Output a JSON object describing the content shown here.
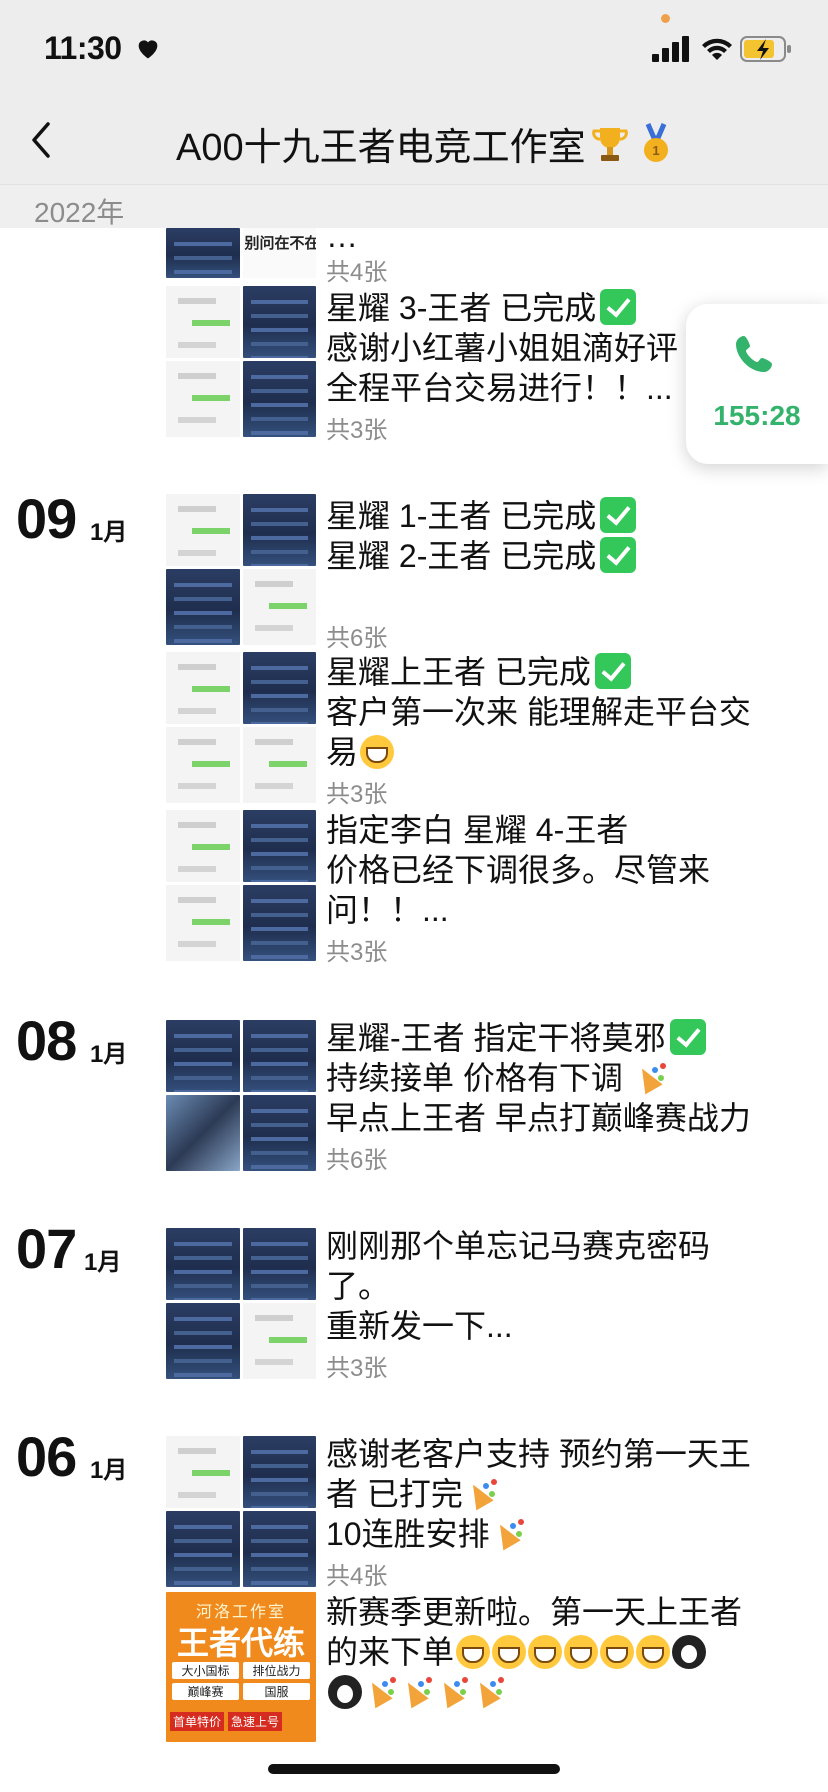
{
  "status": {
    "time": "11:30"
  },
  "nav": {
    "title": "A00十九王者电竞工作室"
  },
  "year": "2022年",
  "call": {
    "duration": "155:28"
  },
  "days": [
    {
      "day": "09",
      "month": "1月"
    },
    {
      "day": "08",
      "month": "1月"
    },
    {
      "day": "07",
      "month": "1月"
    },
    {
      "day": "06",
      "month": "1月"
    }
  ],
  "posts": [
    {
      "lines": [
        "…"
      ],
      "count": "共4张"
    },
    {
      "lines": [
        "星耀 3-王者  已完成",
        "感谢小红薯小姐姐滴好评",
        "全程平台交易进行！！..."
      ],
      "count": "共3张"
    },
    {
      "lines": [
        "星耀 1-王者  已完成",
        "星耀 2-王者  已完成"
      ],
      "count": "共6张"
    },
    {
      "lines": [
        "星耀上王者  已完成",
        "客户第一次来 能理解走平台交",
        "易"
      ],
      "count": "共3张"
    },
    {
      "lines": [
        "指定李白 星耀 4-王者",
        "价格已经下调很多。尽管来",
        "问！！..."
      ],
      "count": "共3张"
    },
    {
      "lines": [
        "星耀-王者 指定干将莫邪",
        "持续接单 价格有下调",
        "早点上王者 早点打巅峰赛战力"
      ],
      "count": "共6张"
    },
    {
      "lines": [
        "刚刚那个单忘记马赛克密码",
        "了。",
        "重新发一下..."
      ],
      "count": "共3张"
    },
    {
      "lines": [
        "感谢老客户支持 预约第一天王",
        "者 已打完",
        "10连胜安排"
      ],
      "count": "共4张"
    },
    {
      "lines": [
        "新赛季更新啦。第一天上王者",
        "的来下单"
      ],
      "count": ""
    }
  ],
  "thumb_texts": {
    "snippet": "别问在不在",
    "promo_brand": "河洛工作室",
    "promo_title": "王者代练",
    "promo_tags": [
      "大小国标",
      "排位战力",
      "巅峰赛",
      "国服"
    ],
    "promo_bottom": [
      "首单特价",
      "急速上号"
    ]
  },
  "colors": {
    "accent_green": "#34c759",
    "call_green": "#33b36b",
    "promo_orange": "#f08a1c"
  }
}
